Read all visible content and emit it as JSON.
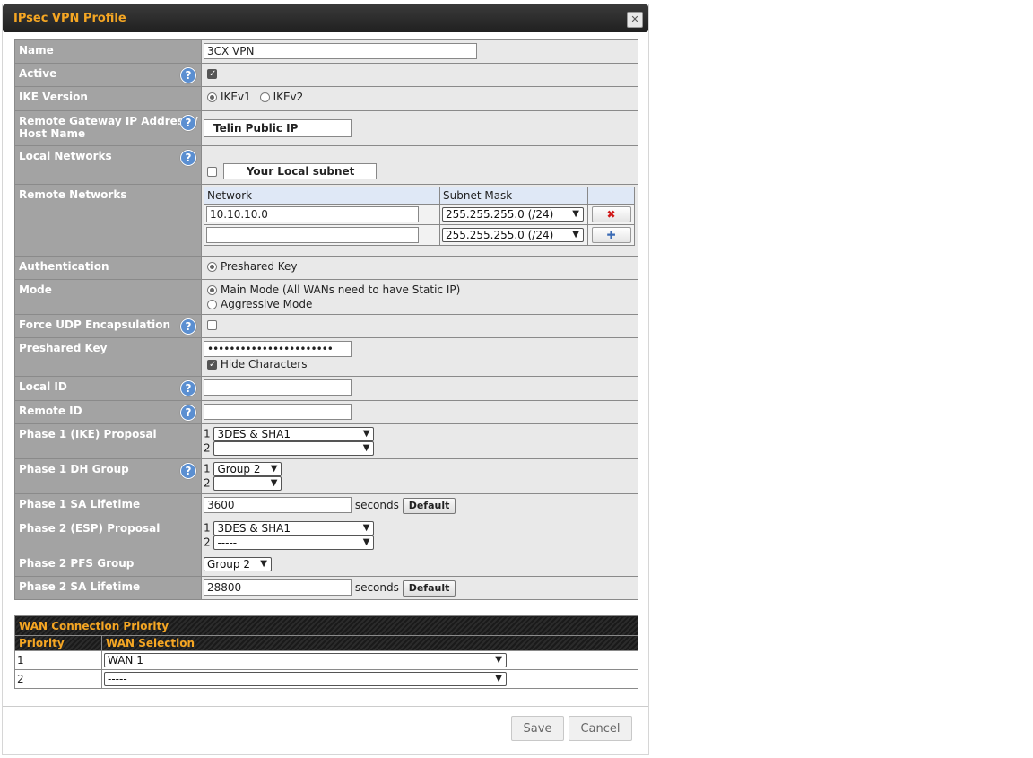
{
  "dialog": {
    "title": "IPsec VPN Profile"
  },
  "fields": {
    "name": {
      "label": "Name",
      "value": "3CX VPN"
    },
    "active": {
      "label": "Active",
      "checked": true
    },
    "ike_version": {
      "label": "IKE Version",
      "options": [
        "IKEv1",
        "IKEv2"
      ],
      "selected": "IKEv1"
    },
    "remote_gateway": {
      "label_line1": "Remote Gateway IP Address /",
      "label_line2": "Host Name",
      "value": "Telin Public IP"
    },
    "local_networks": {
      "label": "Local Networks",
      "value": "Your Local subnet",
      "checked": false
    },
    "remote_networks": {
      "label": "Remote Networks",
      "col_network": "Network",
      "col_mask": "Subnet Mask",
      "rows": [
        {
          "network": "10.10.10.0",
          "mask": "255.255.255.0 (/24)",
          "action": "✖"
        },
        {
          "network": "",
          "mask": "255.255.255.0 (/24)",
          "action": "✚"
        }
      ]
    },
    "authentication": {
      "label": "Authentication",
      "option": "Preshared Key"
    },
    "mode": {
      "label": "Mode",
      "option_main": "Main Mode (All WANs need to have Static IP)",
      "option_aggressive": "Aggressive Mode",
      "selected": "main"
    },
    "force_udp": {
      "label": "Force UDP Encapsulation",
      "checked": false
    },
    "preshared_key": {
      "label": "Preshared Key",
      "value": "•••••••••••••••••••••••",
      "hide_label": "Hide Characters",
      "hide_checked": true
    },
    "local_id": {
      "label": "Local ID",
      "value": ""
    },
    "remote_id": {
      "label": "Remote ID",
      "value": ""
    },
    "phase1_proposal": {
      "label": "Phase 1 (IKE) Proposal",
      "n1": "1",
      "n2": "2",
      "v1": "3DES & SHA1",
      "v2": "-----"
    },
    "phase1_dh": {
      "label": "Phase 1 DH Group",
      "n1": "1",
      "n2": "2",
      "v1": "Group 2",
      "v2": "-----"
    },
    "phase1_lifetime": {
      "label": "Phase 1 SA Lifetime",
      "value": "3600",
      "unit": "seconds",
      "default_label": "Default"
    },
    "phase2_proposal": {
      "label": "Phase 2 (ESP) Proposal",
      "n1": "1",
      "n2": "2",
      "v1": "3DES & SHA1",
      "v2": "-----"
    },
    "phase2_pfs": {
      "label": "Phase 2 PFS Group",
      "value": "Group 2"
    },
    "phase2_lifetime": {
      "label": "Phase 2 SA Lifetime",
      "value": "28800",
      "unit": "seconds",
      "default_label": "Default"
    }
  },
  "wan": {
    "title": "WAN Connection Priority",
    "col_priority": "Priority",
    "col_selection": "WAN Selection",
    "rows": [
      {
        "priority": "1",
        "selection": "WAN 1"
      },
      {
        "priority": "2",
        "selection": "-----"
      }
    ]
  },
  "footer": {
    "save": "Save",
    "cancel": "Cancel"
  },
  "colors": {
    "accent": "#f5a623",
    "label_bg": "#a3a3a3",
    "help_icon": "#5b8fd1"
  }
}
